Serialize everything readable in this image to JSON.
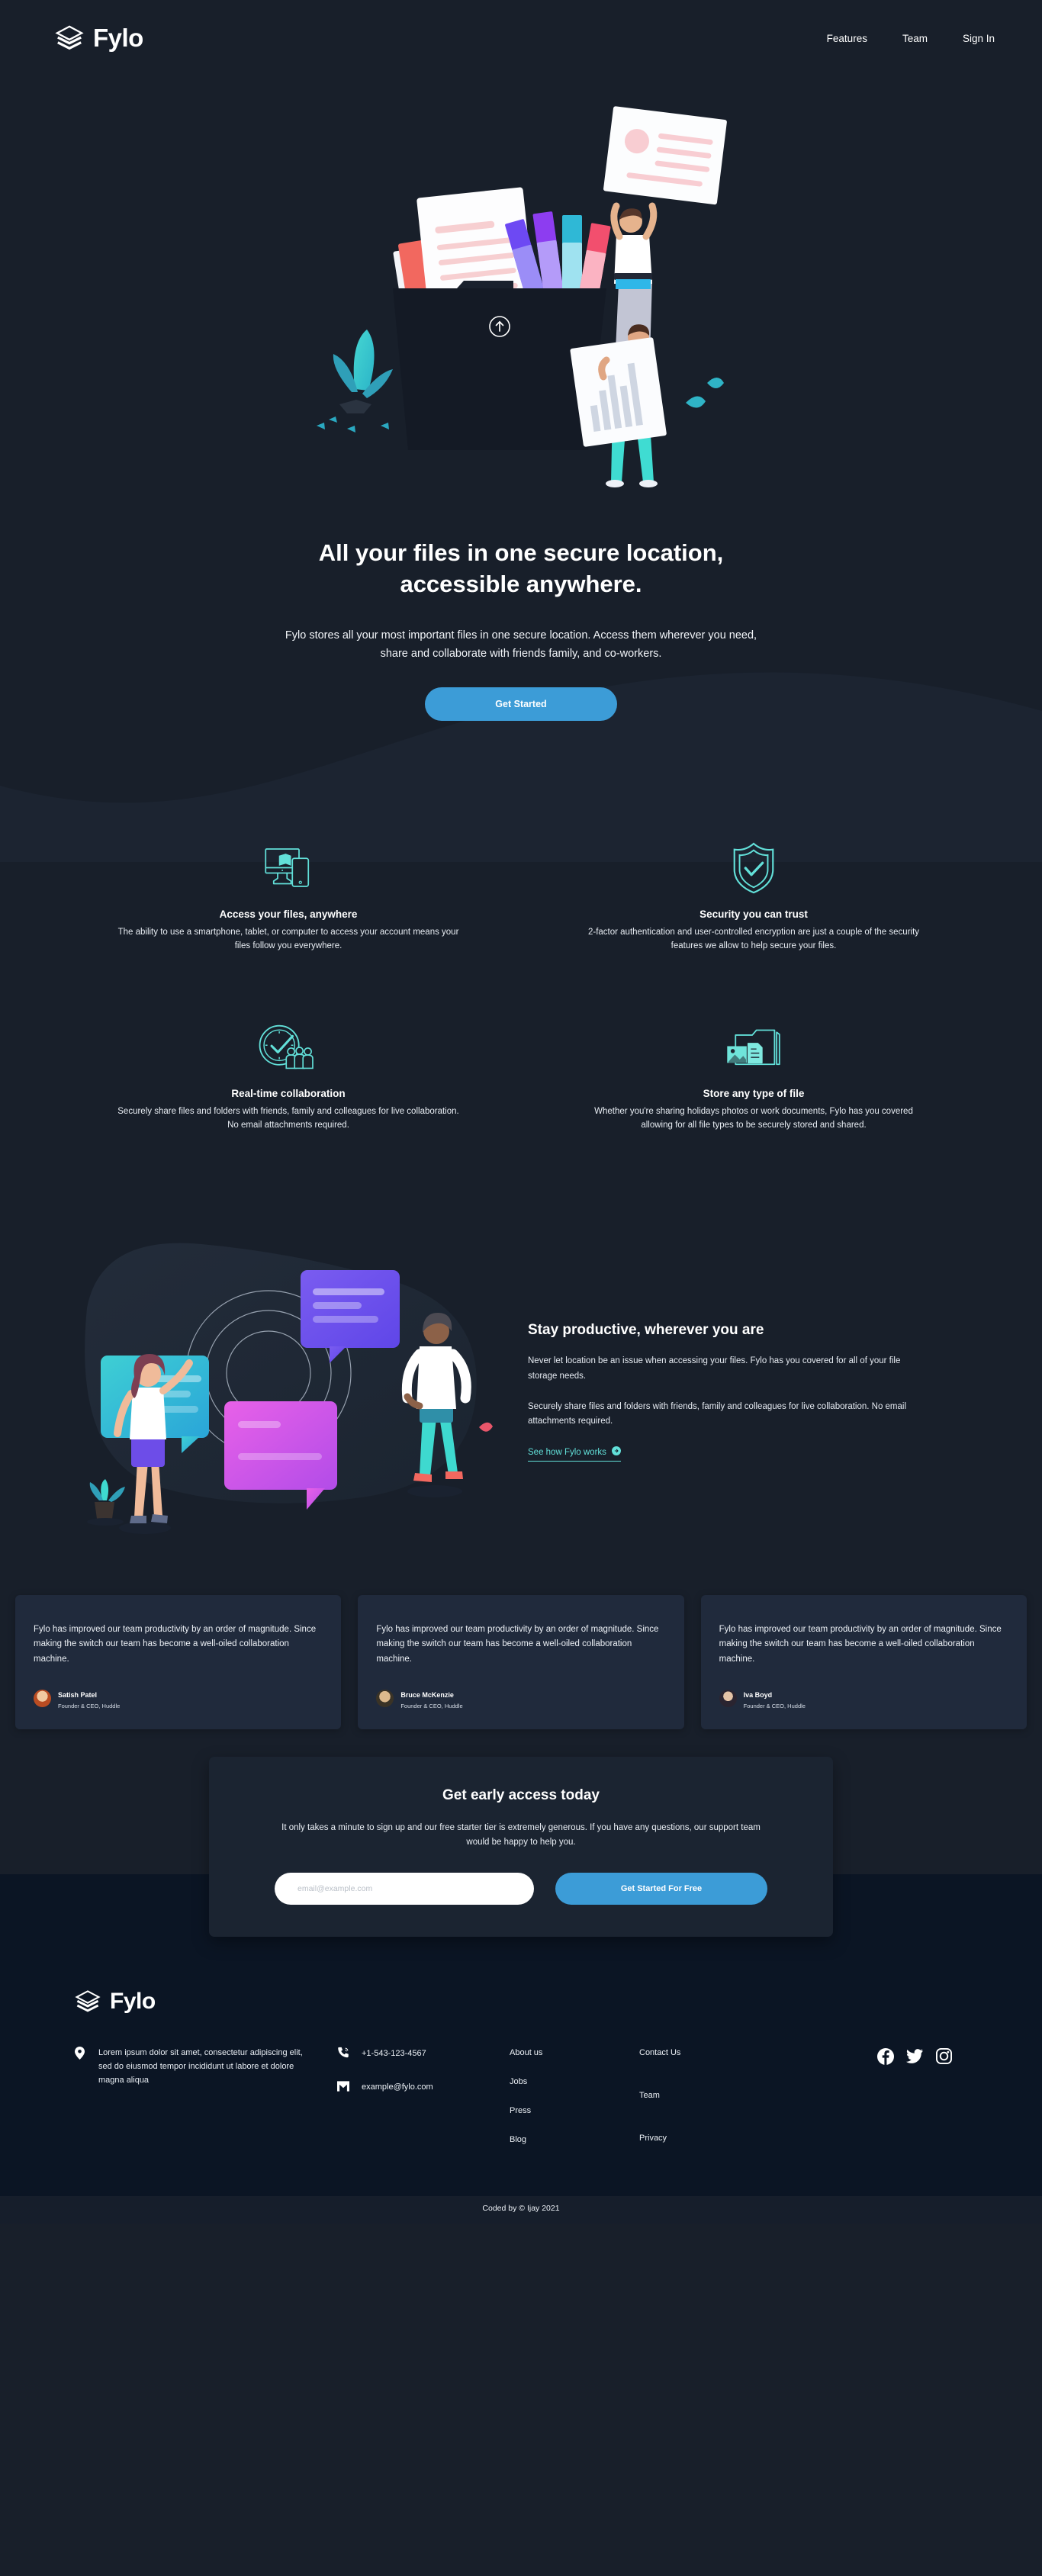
{
  "brand": {
    "name": "Fylo",
    "logo_icon": "layers-icon"
  },
  "nav": {
    "items": [
      {
        "label": "Features"
      },
      {
        "label": "Team"
      },
      {
        "label": "Sign In"
      }
    ]
  },
  "hero": {
    "illustration": "illustration-intro-folder-documents",
    "title_line1": "All your files in one secure location,",
    "title_line2": "accessible anywhere.",
    "subtitle": "Fylo stores all your most important files in one secure location. Access them wherever you need, share and collaborate with friends family, and co-workers.",
    "cta_label": "Get Started"
  },
  "features": [
    {
      "icon": "access-anywhere-icon",
      "title": "Access your files, anywhere",
      "desc": "The ability to use a smartphone, tablet, or computer to access your account means your files follow you everywhere."
    },
    {
      "icon": "shield-check-icon",
      "title": "Security you can trust",
      "desc": "2-factor authentication and user-controlled encryption are just a couple of the security features we allow to help secure your files."
    },
    {
      "icon": "clock-collaboration-icon",
      "title": "Real-time collaboration",
      "desc": "Securely share files and folders with friends, family and colleagues for live collaboration. No email attachments required."
    },
    {
      "icon": "folder-files-icon",
      "title": "Store any type of file",
      "desc": "Whether you're sharing holidays photos or work documents, Fylo has you covered allowing for all file types to be securely stored and shared."
    }
  ],
  "productive": {
    "illustration": "illustration-stay-productive-chat",
    "title": "Stay productive, wherever you are",
    "paragraph1": "Never let location be an issue when accessing your files. Fylo has you covered for all of your file storage needs.",
    "paragraph2": "Securely share files and folders with friends, family and colleagues for live collaboration. No email attachments required.",
    "link_label": "See how Fylo works",
    "link_icon": "arrow-right-circle-icon"
  },
  "testimonials": {
    "quote_mark": "“",
    "items": [
      {
        "text": "Fylo has improved our team productivity by an order of magnitude. Since making the switch our team has become a well-oiled collaboration machine.",
        "name": "Satish Patel",
        "role": "Founder & CEO, Huddle"
      },
      {
        "text": "Fylo has improved our team productivity by an order of magnitude. Since making the switch our team has become a well-oiled collaboration machine.",
        "name": "Bruce McKenzie",
        "role": "Founder & CEO, Huddle"
      },
      {
        "text": "Fylo has improved our team productivity by an order of magnitude. Since making the switch our team has become a well-oiled collaboration machine.",
        "name": "Iva Boyd",
        "role": "Founder & CEO, Huddle"
      }
    ]
  },
  "early_access": {
    "title": "Get early access today",
    "desc": "It only takes a minute to sign up and our free starter tier is extremely generous. If you have any questions, our support team would be happy to help you.",
    "email_placeholder": "email@example.com",
    "email_value": "",
    "cta_label": "Get Started For Free"
  },
  "footer": {
    "address": "Lorem ipsum dolor sit amet, consectetur adipiscing elit, sed do eiusmod tempor incididunt ut labore et dolore magna aliqua",
    "phone": "+1-543-123-4567",
    "email": "example@fylo.com",
    "links_col1": [
      {
        "label": "About us"
      },
      {
        "label": "Jobs"
      },
      {
        "label": "Press"
      },
      {
        "label": "Blog"
      }
    ],
    "links_col2": [
      {
        "label": "Contact Us"
      },
      {
        "label": "Team"
      },
      {
        "label": "Privacy"
      }
    ],
    "social": [
      {
        "icon": "facebook-icon"
      },
      {
        "icon": "twitter-icon"
      },
      {
        "icon": "instagram-icon"
      }
    ],
    "attribution": "Coded by © Ijay 2021"
  },
  "colors": {
    "bg_main": "#181F2A",
    "bg_footer": "#0B1524",
    "bg_card": "#202A3C",
    "accent_blue": "#3C9CD7",
    "accent_cyan": "#62E0D9"
  }
}
